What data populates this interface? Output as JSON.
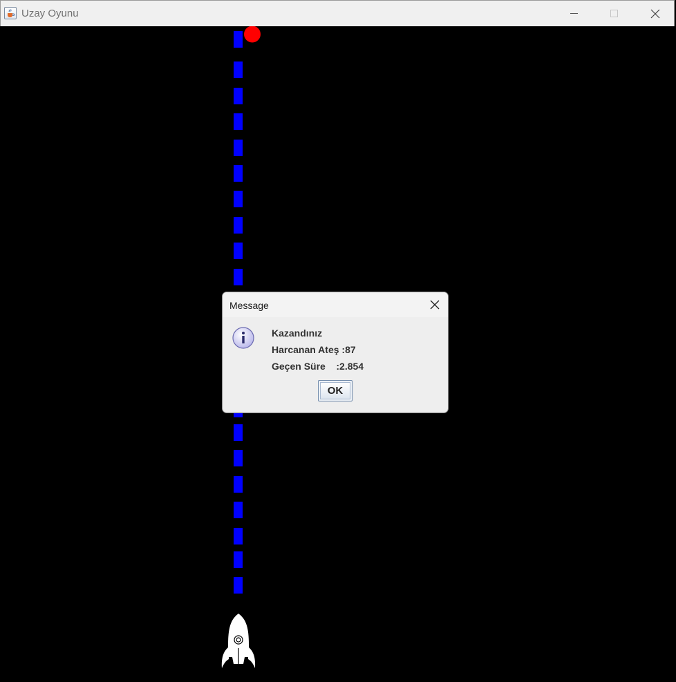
{
  "window": {
    "title": "Uzay Oyunu",
    "icon": "java-cup-icon"
  },
  "game": {
    "background_color": "#000000",
    "laser_color": "#0000ff",
    "target_color": "#ff0000",
    "ship_color": "#ffffff",
    "ship_icon": "rocket-icon"
  },
  "dialog": {
    "title": "Message",
    "icon": "info-icon",
    "line1": "Kazandınız",
    "line2": "Harcanan Ateş :87",
    "line3": "Geçen Süre    :2.854",
    "ok_label": "OK"
  }
}
